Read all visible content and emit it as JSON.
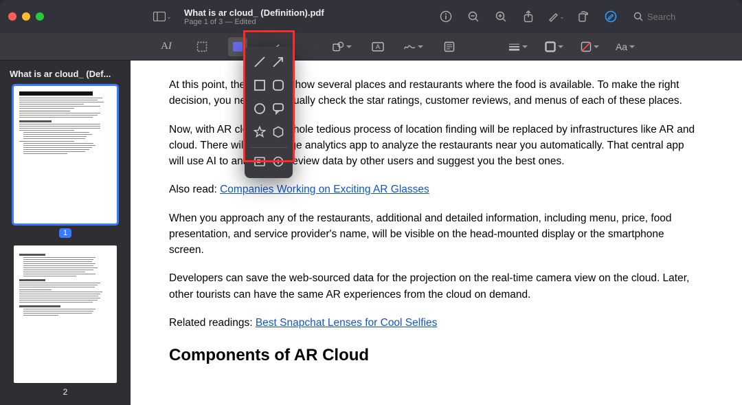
{
  "header": {
    "doc_title": "What is ar cloud_ (Definition).pdf",
    "page_status": "Page 1 of 3  —  Edited",
    "search_placeholder": "Search"
  },
  "sidebar": {
    "title": "What is ar cloud_ (Def...",
    "pages": [
      "1",
      "2"
    ]
  },
  "markup": {
    "font_label": "Aa"
  },
  "shapes_popover": {
    "items": [
      "line-icon",
      "arrow-icon",
      "square-icon",
      "rounded-square-icon",
      "circle-icon",
      "speech-bubble-icon",
      "star-icon",
      "hexagon-icon",
      "mask-square-icon",
      "loupe-icon"
    ]
  },
  "document": {
    "p1": "At this point, the map will show several places and restaurants where the food is available. To make the right decision, you need to manually check the star ratings, customer reviews, and menus of each of these places.",
    "p2": "Now, with AR cloud, this whole tedious process of location finding will be replaced by infrastructures like AR and cloud. There will be an edge analytics app to analyze the restaurants near you automatically. That central app will use AI to analyze the review data by other users and suggest you the best ones.",
    "also_read_prefix": "Also read: ",
    "also_read_link": "Companies Working on Exciting AR Glasses",
    "p3": "When you approach any of the restaurants, additional and detailed information, including menu, price, food presentation, and service provider's name, will be visible on the head-mounted display or the smartphone screen.",
    "p4": "Developers can save the web-sourced data for the projection on the real-time camera view on the cloud. Later, other tourists can have the same AR experiences from the cloud on demand.",
    "related_prefix": "Related readings: ",
    "related_link": "Best Snapchat Lenses for Cool Selfies",
    "h2": "Components of AR Cloud"
  }
}
